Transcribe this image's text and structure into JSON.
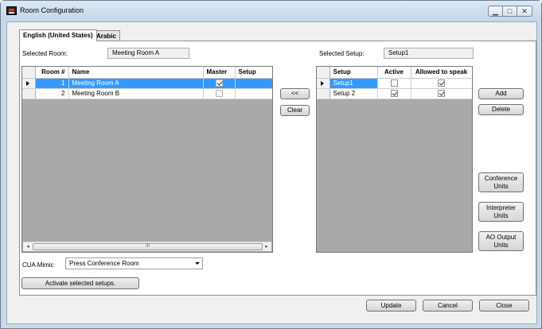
{
  "window": {
    "title": "Room Configuration",
    "min_glyph": "▁",
    "max_glyph": "□",
    "close_glyph": "✕"
  },
  "tabs": [
    {
      "label": "English (United States)"
    },
    {
      "label": "Arabic"
    }
  ],
  "selected_room": {
    "label": "Selected Room:",
    "value": "Meeting Room A"
  },
  "selected_setup": {
    "label": "Selected Setup:",
    "value": "Setup1"
  },
  "rooms_grid": {
    "columns": [
      "Room #",
      "Name",
      "Master",
      "Setup"
    ],
    "rows": [
      {
        "number": "1",
        "name": "Meeting Room A",
        "master": true,
        "setup": "",
        "selected": true
      },
      {
        "number": "2",
        "name": "Meeting Room B",
        "master": false,
        "setup": "",
        "selected": false
      }
    ],
    "scroll_thumb_glyph": "III"
  },
  "setups_grid": {
    "columns": [
      "Setup",
      "Active",
      "Allowed to speak"
    ],
    "rows": [
      {
        "name": "Setup1",
        "active": false,
        "allowed": true,
        "selected": true
      },
      {
        "name": "Setup 2",
        "active": true,
        "allowed": true,
        "selected": false
      }
    ]
  },
  "middle_buttons": {
    "move_label": "<<",
    "clear_label": "Clear"
  },
  "right_buttons": {
    "add": "Add",
    "delete": "Delete",
    "conference_units": "Conference\nUnits",
    "interpreter_units": "Interpreter\nUnits",
    "ao_output_units": "AO Output\nUnits"
  },
  "cua_mimic": {
    "label": "CUA Mimic",
    "value": "Press Conference Room"
  },
  "activate_button": "Activate selected setups.",
  "footer": {
    "update": "Update",
    "cancel": "Cancel",
    "close": "Close"
  }
}
